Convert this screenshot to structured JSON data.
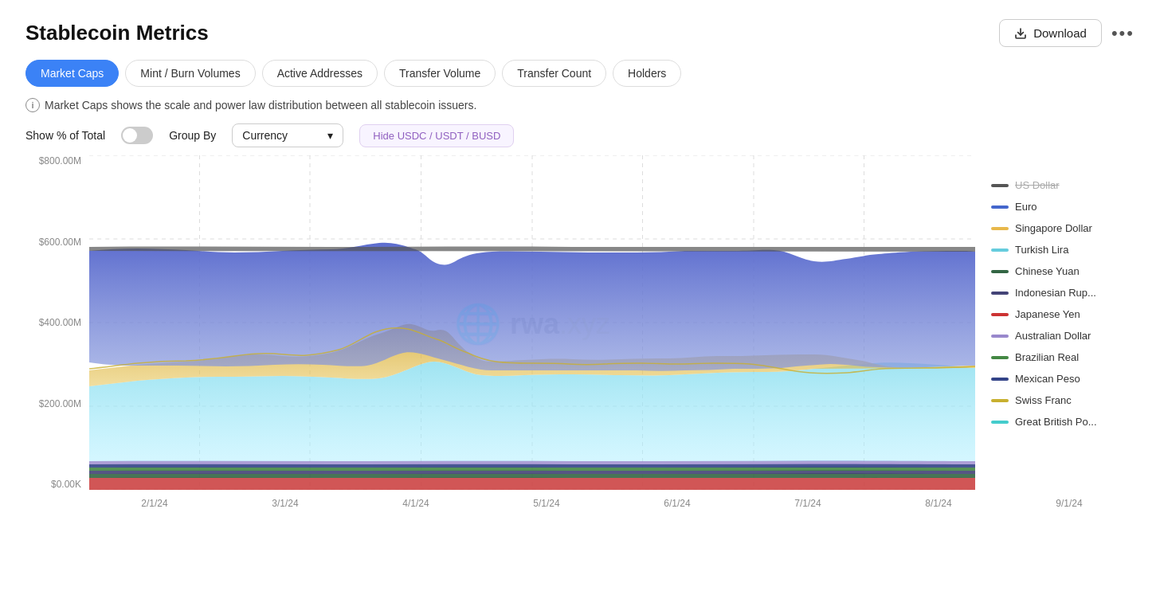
{
  "page": {
    "title": "Stablecoin Metrics"
  },
  "header": {
    "download_label": "Download",
    "more_icon": "•••"
  },
  "tabs": [
    {
      "id": "market-caps",
      "label": "Market Caps",
      "active": true
    },
    {
      "id": "mint-burn",
      "label": "Mint / Burn Volumes",
      "active": false
    },
    {
      "id": "active-addresses",
      "label": "Active Addresses",
      "active": false
    },
    {
      "id": "transfer-volume",
      "label": "Transfer Volume",
      "active": false
    },
    {
      "id": "transfer-count",
      "label": "Transfer Count",
      "active": false
    },
    {
      "id": "holders",
      "label": "Holders",
      "active": false
    }
  ],
  "info": {
    "text": "Market Caps shows the scale and power law distribution between all stablecoin issuers."
  },
  "controls": {
    "show_pct_label": "Show % of Total",
    "group_by_label": "Group By",
    "group_by_value": "Currency",
    "hide_button_label": "Hide USDC / USDT / BUSD"
  },
  "yaxis": {
    "labels": [
      "$800.00M",
      "$600.00M",
      "$400.00M",
      "$200.00M",
      "$0.00K"
    ]
  },
  "xaxis": {
    "labels": [
      "2/1/24",
      "3/1/24",
      "4/1/24",
      "5/1/24",
      "6/1/24",
      "7/1/24",
      "8/1/24",
      "9/1/24"
    ]
  },
  "legend": [
    {
      "label": "US Dollar",
      "color": "#555555",
      "strikethrough": true
    },
    {
      "label": "Euro",
      "color": "#4466cc"
    },
    {
      "label": "Singapore Dollar",
      "color": "#e8b84b"
    },
    {
      "label": "Turkish Lira",
      "color": "#66ccdd"
    },
    {
      "label": "Chinese Yuan",
      "color": "#336644"
    },
    {
      "label": "Indonesian Rup...",
      "color": "#3a3a6a"
    },
    {
      "label": "Japanese Yen",
      "color": "#cc3333"
    },
    {
      "label": "Australian Dollar",
      "color": "#9988cc"
    },
    {
      "label": "Brazilian Real",
      "color": "#448844"
    },
    {
      "label": "Mexican Peso",
      "color": "#334488"
    },
    {
      "label": "Swiss Franc",
      "color": "#c8b84a"
    },
    {
      "label": "Great British Po...",
      "color": "#44cccc"
    }
  ],
  "watermark": {
    "text": "rwa.xyz"
  }
}
